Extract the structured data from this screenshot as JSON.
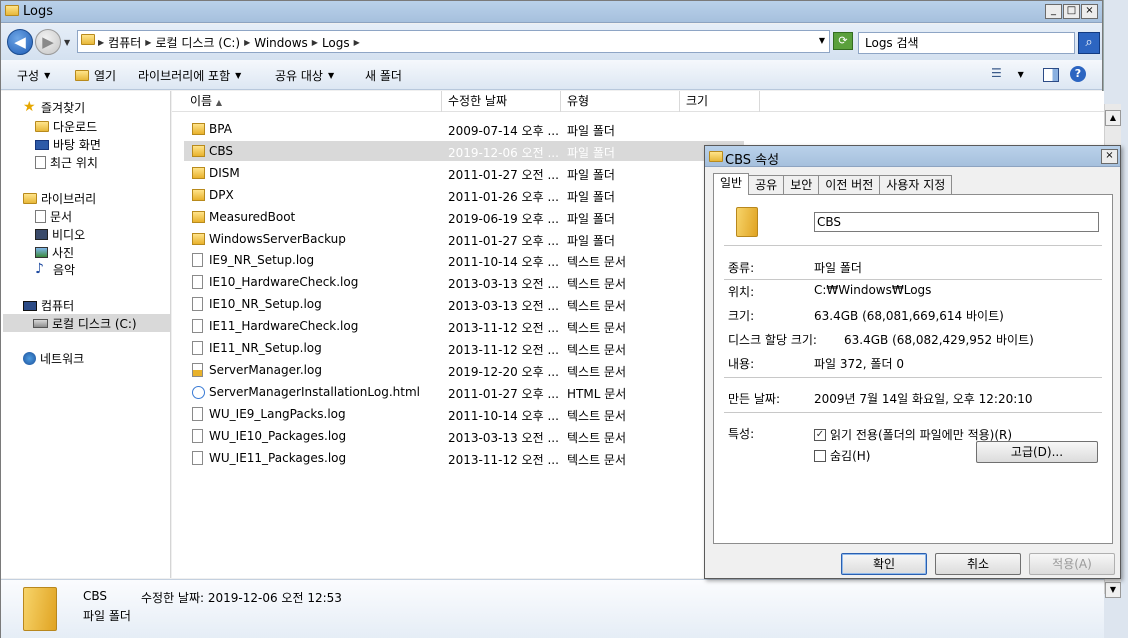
{
  "window": {
    "title": "Logs",
    "controls": [
      "_",
      "□",
      "×"
    ]
  },
  "address": {
    "crumbs": [
      "컴퓨터",
      "로컬 디스크 (C:)",
      "Windows",
      "Logs"
    ],
    "search_placeholder": "Logs 검색"
  },
  "toolbar": {
    "organize": "구성",
    "open": "열기",
    "include_library": "라이브러리에 포함",
    "share": "공유 대상",
    "new_folder": "새 폴더"
  },
  "nav": {
    "favorites": "즐겨찾기",
    "downloads": "다운로드",
    "desktop": "바탕 화면",
    "recent": "최근 위치",
    "libraries": "라이브러리",
    "documents": "문서",
    "videos": "비디오",
    "pictures": "사진",
    "music": "음악",
    "computer": "컴퓨터",
    "local_disk": "로컬 디스크 (C:)",
    "network": "네트워크"
  },
  "columns": {
    "name": "이름",
    "modified": "수정한 날짜",
    "type": "유형",
    "size": "크기"
  },
  "files": [
    {
      "name": "BPA",
      "date": "2009-07-14 오후 ...",
      "type": "파일 폴더",
      "icon": "folder"
    },
    {
      "name": "CBS",
      "date": "2019-12-06 오전 ...",
      "type": "파일 폴더",
      "icon": "folder"
    },
    {
      "name": "DISM",
      "date": "2011-01-27 오전 ...",
      "type": "파일 폴더",
      "icon": "folder"
    },
    {
      "name": "DPX",
      "date": "2011-01-26 오후 ...",
      "type": "파일 폴더",
      "icon": "folder"
    },
    {
      "name": "MeasuredBoot",
      "date": "2019-06-19 오후 ...",
      "type": "파일 폴더",
      "icon": "folder"
    },
    {
      "name": "WindowsServerBackup",
      "date": "2011-01-27 오후 ...",
      "type": "파일 폴더",
      "icon": "folder"
    },
    {
      "name": "IE9_NR_Setup.log",
      "date": "2011-10-14 오후 ...",
      "type": "텍스트 문서",
      "icon": "text"
    },
    {
      "name": "IE10_HardwareCheck.log",
      "date": "2013-03-13 오전 ...",
      "type": "텍스트 문서",
      "icon": "text"
    },
    {
      "name": "IE10_NR_Setup.log",
      "date": "2013-03-13 오전 ...",
      "type": "텍스트 문서",
      "icon": "text"
    },
    {
      "name": "IE11_HardwareCheck.log",
      "date": "2013-11-12 오전 ...",
      "type": "텍스트 문서",
      "icon": "text"
    },
    {
      "name": "IE11_NR_Setup.log",
      "date": "2013-11-12 오전 ...",
      "type": "텍스트 문서",
      "icon": "text"
    },
    {
      "name": "ServerManager.log",
      "date": "2019-12-20 오후 ...",
      "type": "텍스트 문서",
      "icon": "log"
    },
    {
      "name": "ServerManagerInstallationLog.html",
      "date": "2011-01-27 오후 ...",
      "type": "HTML 문서",
      "icon": "html"
    },
    {
      "name": "WU_IE9_LangPacks.log",
      "date": "2011-10-14 오후 ...",
      "type": "텍스트 문서",
      "icon": "text"
    },
    {
      "name": "WU_IE10_Packages.log",
      "date": "2013-03-13 오전 ...",
      "type": "텍스트 문서",
      "icon": "text"
    },
    {
      "name": "WU_IE11_Packages.log",
      "date": "2013-11-12 오전 ...",
      "type": "텍스트 문서",
      "icon": "text"
    }
  ],
  "selected_index": 1,
  "details": {
    "name": "CBS",
    "modified": "수정한 날짜: 2019-12-06 오전 12:53",
    "type": "파일 폴더"
  },
  "props": {
    "title": "CBS 속성",
    "tabs": [
      "일반",
      "공유",
      "보안",
      "이전 버전",
      "사용자 지정"
    ],
    "name_value": "CBS",
    "type_label": "종류:",
    "type_value": "파일 폴더",
    "location_label": "위치:",
    "location_value": "C:₩Windows₩Logs",
    "size_label": "크기:",
    "size_value": "63.4GB (68,081,669,614 바이트)",
    "disk_size_label": "디스크 할당 크기:",
    "disk_size_value": "63.4GB (68,082,429,952 바이트)",
    "contains_label": "내용:",
    "contains_value": "파일 372, 폴더 0",
    "created_label": "만든 날짜:",
    "created_value": "2009년 7월 14일 화요일, 오후 12:20:10",
    "attributes_label": "특성:",
    "readonly_label": "읽기 전용(폴더의 파일에만 적용)(R)",
    "hidden_label": "숨김(H)",
    "advanced_label": "고급(D)...",
    "ok_label": "확인",
    "cancel_label": "취소",
    "apply_label": "적용(A)"
  }
}
